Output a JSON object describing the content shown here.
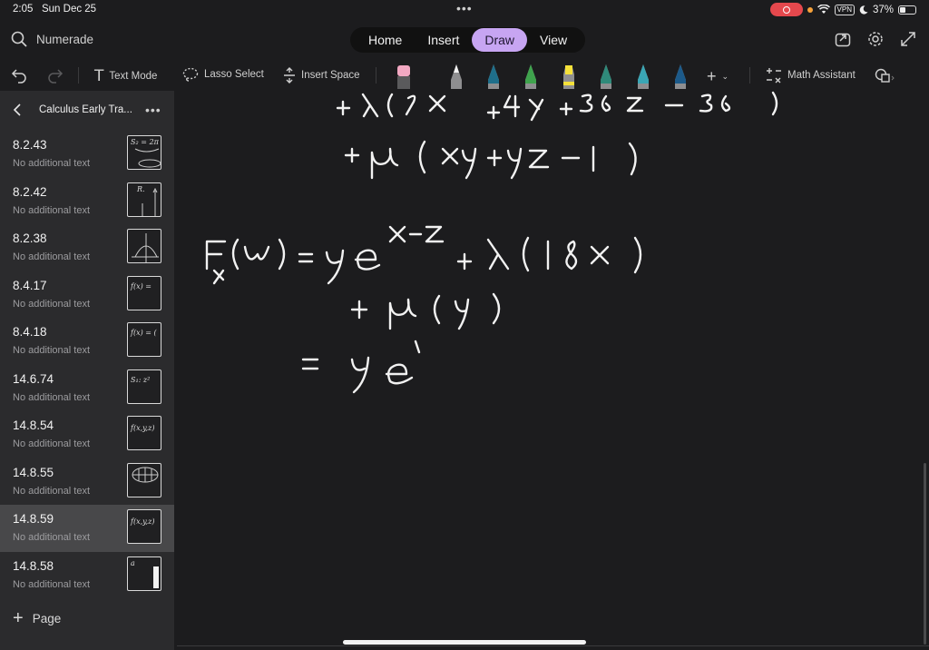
{
  "status_bar": {
    "time": "2:05",
    "date": "Sun Dec 25",
    "vpn": "VPN",
    "battery": "37%"
  },
  "search": {
    "placeholder": "Numerade"
  },
  "tabs": [
    {
      "label": "Home"
    },
    {
      "label": "Insert"
    },
    {
      "label": "Draw",
      "active": true
    },
    {
      "label": "View"
    }
  ],
  "toolbar": {
    "text_mode": "Text Mode",
    "lasso_select": "Lasso Select",
    "insert_space": "Insert Space",
    "math_assistant": "Math Assistant"
  },
  "pens": [
    {
      "name": "eraser-tool",
      "color": "#f2a8c2"
    },
    {
      "name": "pen-white",
      "color": "#f2f2f2"
    },
    {
      "name": "pen-teal",
      "color": "#1f6f8b"
    },
    {
      "name": "pen-green",
      "color": "#3fa34d"
    },
    {
      "name": "highlighter-yellow",
      "color": "#f5e13a"
    },
    {
      "name": "pen-sea",
      "color": "#2f8a7a"
    },
    {
      "name": "pen-cyan",
      "color": "#3aa6b5"
    },
    {
      "name": "pen-blue",
      "color": "#1c5a8a"
    }
  ],
  "sidebar": {
    "notebook_title": "Calculus Early Tra...",
    "items": [
      {
        "label": "8.2.43",
        "sub": "No additional text",
        "thumb": "S₂ = 2π"
      },
      {
        "label": "8.2.42",
        "sub": "No additional text",
        "thumb": "R."
      },
      {
        "label": "8.2.38",
        "sub": "No additional text",
        "thumb": ""
      },
      {
        "label": "8.4.17",
        "sub": "No additional text",
        "thumb": "f(x) ="
      },
      {
        "label": "8.4.18",
        "sub": "No additional text",
        "thumb": "f(x) = ("
      },
      {
        "label": "14.6.74",
        "sub": "No additional text",
        "thumb": "S₁: z²"
      },
      {
        "label": "14.8.54",
        "sub": "No additional text",
        "thumb": "f(x,y,z)"
      },
      {
        "label": "14.8.55",
        "sub": "No additional text",
        "thumb": ""
      },
      {
        "label": "14.8.59",
        "sub": "No additional text",
        "thumb": "f(x,y,z)",
        "selected": true
      },
      {
        "label": "14.8.58",
        "sub": "No additional text",
        "thumb": "a"
      }
    ],
    "add_page_label": "Page"
  },
  "colors": {
    "accent": "#c7a5f2",
    "ink": "#f2f2f2",
    "background": "#1c1c1e",
    "sidebar": "#2b2b2d"
  }
}
